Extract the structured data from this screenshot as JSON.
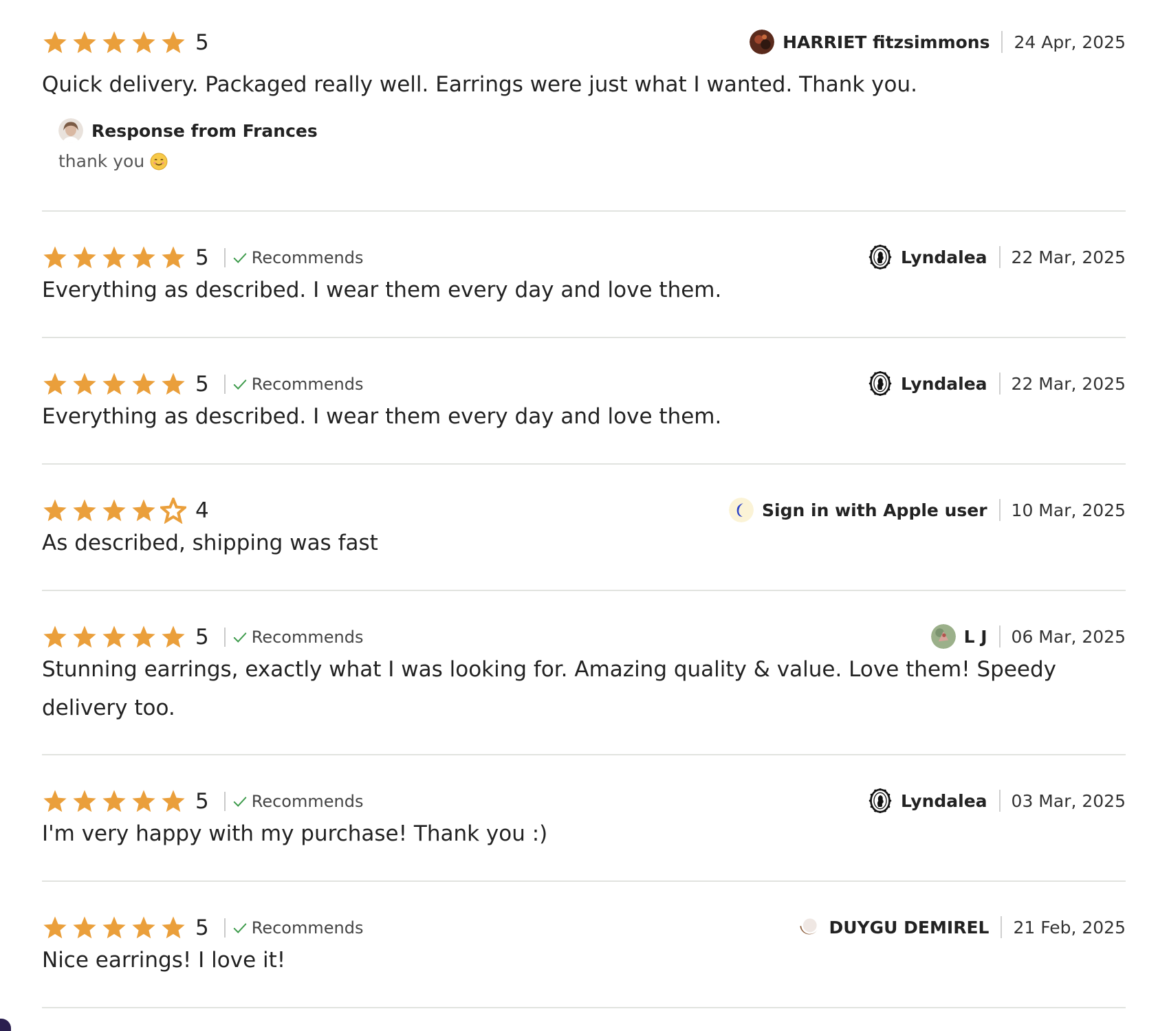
{
  "reviews": [
    {
      "rating": "5",
      "stars": 5,
      "recommends": false,
      "reviewer": "HARRIET fitzsimmons",
      "date": "24 Apr, 2025",
      "avatar": "photo-avatar",
      "text": "Quick delivery. Packaged really well. Earrings were just what I wanted. Thank you.",
      "response": {
        "from": "Response from Frances",
        "text": "thank you",
        "emoji": "smiling-face-icon"
      }
    },
    {
      "rating": "5",
      "stars": 5,
      "recommends": true,
      "recommends_label": "Recommends",
      "reviewer": "Lyndalea",
      "date": "22 Mar, 2025",
      "avatar": "cameo-avatar",
      "text": "Everything as described. I wear them every day and love them."
    },
    {
      "rating": "5",
      "stars": 5,
      "recommends": true,
      "recommends_label": "Recommends",
      "reviewer": "Lyndalea",
      "date": "22 Mar, 2025",
      "avatar": "cameo-avatar",
      "text": "Everything as described. I wear them every day and love them."
    },
    {
      "rating": "4",
      "stars": 4,
      "recommends": false,
      "reviewer": "Sign in with Apple user",
      "date": "10 Mar, 2025",
      "avatar": "moon-avatar",
      "text": "As described, shipping was fast"
    },
    {
      "rating": "5",
      "stars": 5,
      "recommends": true,
      "recommends_label": "Recommends",
      "reviewer": "L J",
      "date": "06 Mar, 2025",
      "avatar": "photo-avatar-green",
      "text": "Stunning earrings, exactly what I was looking for. Amazing quality & value. Love them! Speedy delivery too."
    },
    {
      "rating": "5",
      "stars": 5,
      "recommends": true,
      "recommends_label": "Recommends",
      "reviewer": "Lyndalea",
      "date": "03 Mar, 2025",
      "avatar": "cameo-avatar",
      "text": "I'm very happy with my purchase! Thank you :)"
    },
    {
      "rating": "5",
      "stars": 5,
      "recommends": true,
      "recommends_label": "Recommends",
      "reviewer": "DUYGU DEMIREL",
      "date": "21 Feb, 2025",
      "avatar": "circle-avatar",
      "text": "Nice earrings! I love it!"
    }
  ],
  "colors": {
    "star": "#ea9f3b",
    "check": "#3c9a4a",
    "divider": "#e1e3df",
    "text": "#222222"
  }
}
